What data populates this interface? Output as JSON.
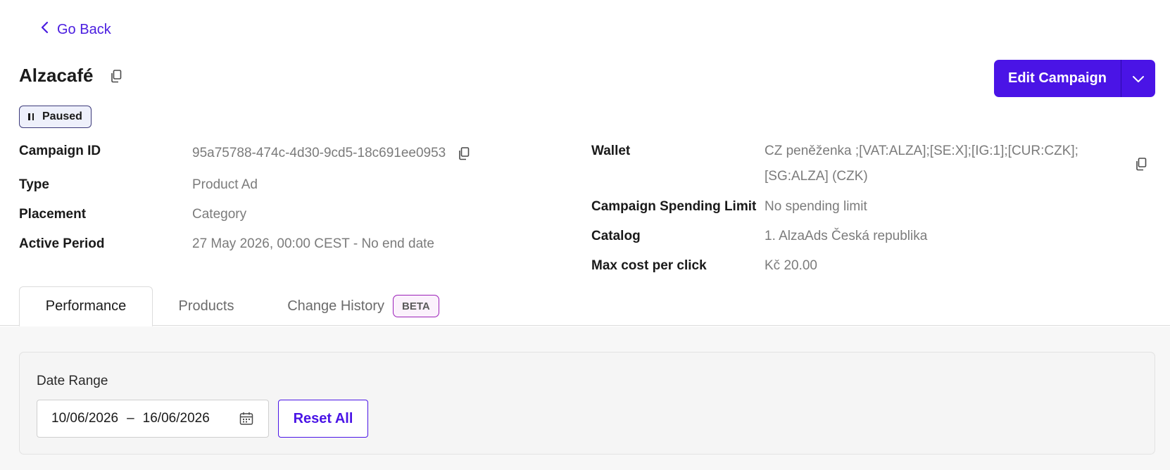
{
  "nav": {
    "go_back_label": "Go Back"
  },
  "campaign": {
    "title": "Alzacafé",
    "status": "Paused",
    "edit_label": "Edit Campaign"
  },
  "details_left": [
    {
      "label": "Campaign ID",
      "value": "95a75788-474c-4d30-9cd5-18c691ee0953"
    },
    {
      "label": "Type",
      "value": "Product Ad"
    },
    {
      "label": "Placement",
      "value": "Category"
    },
    {
      "label": "Active Period",
      "value": "27 May 2026, 00:00 CEST - No end date"
    }
  ],
  "details_right": [
    {
      "label": "Wallet",
      "value_line1": "CZ peněženka ;[VAT:ALZA];[SE:X];[IG:1];[CUR:CZK];",
      "value_line2": "[SG:ALZA] (CZK)"
    },
    {
      "label": "Campaign Spending Limit",
      "value": "No spending limit"
    },
    {
      "label": "Catalog",
      "value": "1. AlzaAds Česká republika"
    },
    {
      "label": "Max cost per click",
      "value": "Kč 20.00"
    }
  ],
  "tabs": [
    {
      "label": "Performance",
      "active": true
    },
    {
      "label": "Products",
      "active": false
    },
    {
      "label": "Change History",
      "active": false,
      "badge": "BETA"
    }
  ],
  "filters": {
    "date_range_label": "Date Range",
    "date_from": "10/06/2026",
    "date_separator": "–",
    "date_to": "16/06/2026",
    "reset_label": "Reset All"
  },
  "colors": {
    "accent": "#4a14e6",
    "link": "#4a1de0",
    "muted_text": "#7b7b7b",
    "beta_border": "#9b1fb8"
  },
  "icons": {
    "back": "chevron-left-icon",
    "copy": "copy-icon",
    "pause": "pause-icon",
    "caret": "chevron-down-icon",
    "calendar": "calendar-icon"
  }
}
